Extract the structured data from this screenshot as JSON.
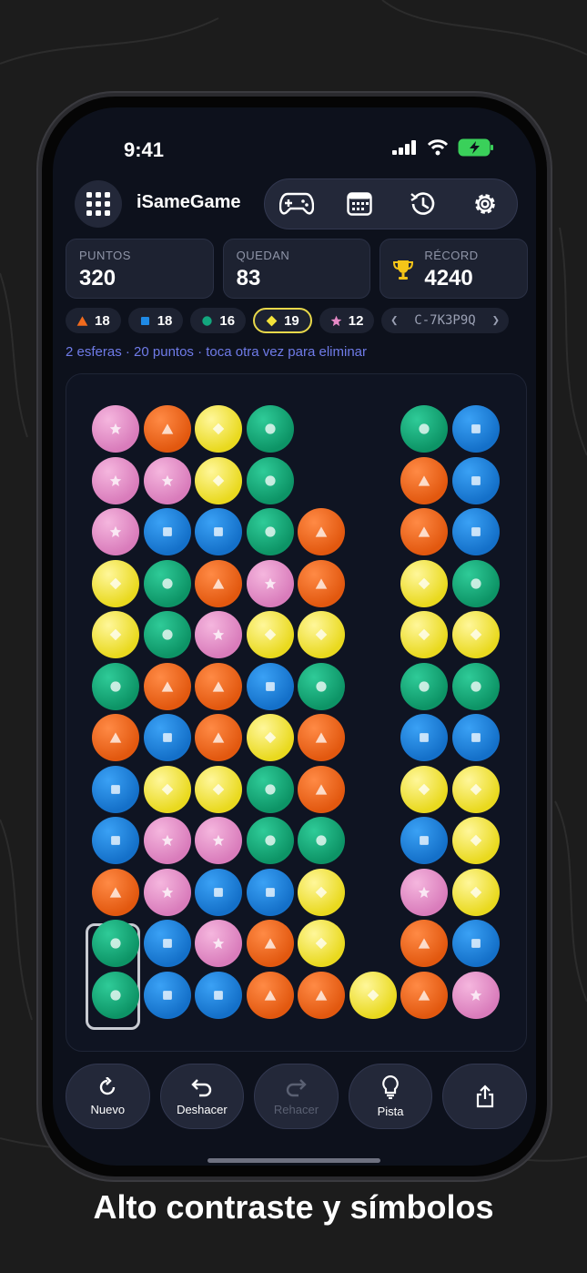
{
  "status_bar": {
    "time": "9:41"
  },
  "header": {
    "app_title": "iSameGame"
  },
  "stats": [
    {
      "label": "PUNTOS",
      "value": "320"
    },
    {
      "label": "QUEDAN",
      "value": "83"
    },
    {
      "label": "RÉCORD",
      "value": "4240"
    }
  ],
  "color_counts": [
    {
      "shape": "triangle",
      "color": "#f26b1d",
      "count": "18"
    },
    {
      "shape": "square",
      "color": "#1f8ae6",
      "count": "18"
    },
    {
      "shape": "circle",
      "color": "#13a77e",
      "count": "16"
    },
    {
      "shape": "diamond",
      "color": "#f4e33a",
      "count": "19",
      "selected": true
    },
    {
      "shape": "star",
      "color": "#e68ac6",
      "count": "12"
    }
  ],
  "seed": {
    "code": "C-7K3P9Q"
  },
  "hint_text": "2 esferas · 20 puntos · toca otra vez para eliminar",
  "board": {
    "rows": [
      [
        "P",
        "O",
        "Y",
        "G",
        "",
        "",
        "G",
        "B"
      ],
      [
        "P",
        "P",
        "Y",
        "G",
        "",
        "",
        "O",
        "B"
      ],
      [
        "P",
        "B",
        "B",
        "G",
        "O",
        "",
        "O",
        "B"
      ],
      [
        "Y",
        "G",
        "O",
        "P",
        "O",
        "",
        "Y",
        "G"
      ],
      [
        "Y",
        "G",
        "P",
        "Y",
        "Y",
        "",
        "Y",
        "Y"
      ],
      [
        "G",
        "O",
        "O",
        "B",
        "G",
        "",
        "G",
        "G"
      ],
      [
        "O",
        "B",
        "O",
        "Y",
        "O",
        "",
        "B",
        "B"
      ],
      [
        "B",
        "Y",
        "Y",
        "G",
        "O",
        "",
        "Y",
        "Y"
      ],
      [
        "B",
        "P",
        "P",
        "G",
        "G",
        "",
        "B",
        "Y"
      ],
      [
        "O",
        "P",
        "B",
        "B",
        "Y",
        "",
        "P",
        "Y"
      ],
      [
        "G",
        "B",
        "P",
        "O",
        "Y",
        "",
        "O",
        "B"
      ],
      [
        "G",
        "B",
        "B",
        "O",
        "O",
        "Y",
        "O",
        "P"
      ]
    ],
    "selected_cells": [
      [
        10,
        0
      ],
      [
        11,
        0
      ]
    ]
  },
  "actions": [
    {
      "label": "Nuevo",
      "icon": "refresh-icon",
      "enabled": true
    },
    {
      "label": "Deshacer",
      "icon": "undo-icon",
      "enabled": true
    },
    {
      "label": "Rehacer",
      "icon": "redo-icon",
      "enabled": false
    },
    {
      "label": "Pista",
      "icon": "lightbulb-icon",
      "enabled": true
    },
    {
      "label": "",
      "icon": "share-icon",
      "enabled": true
    }
  ],
  "caption": "Alto contraste y símbolos"
}
